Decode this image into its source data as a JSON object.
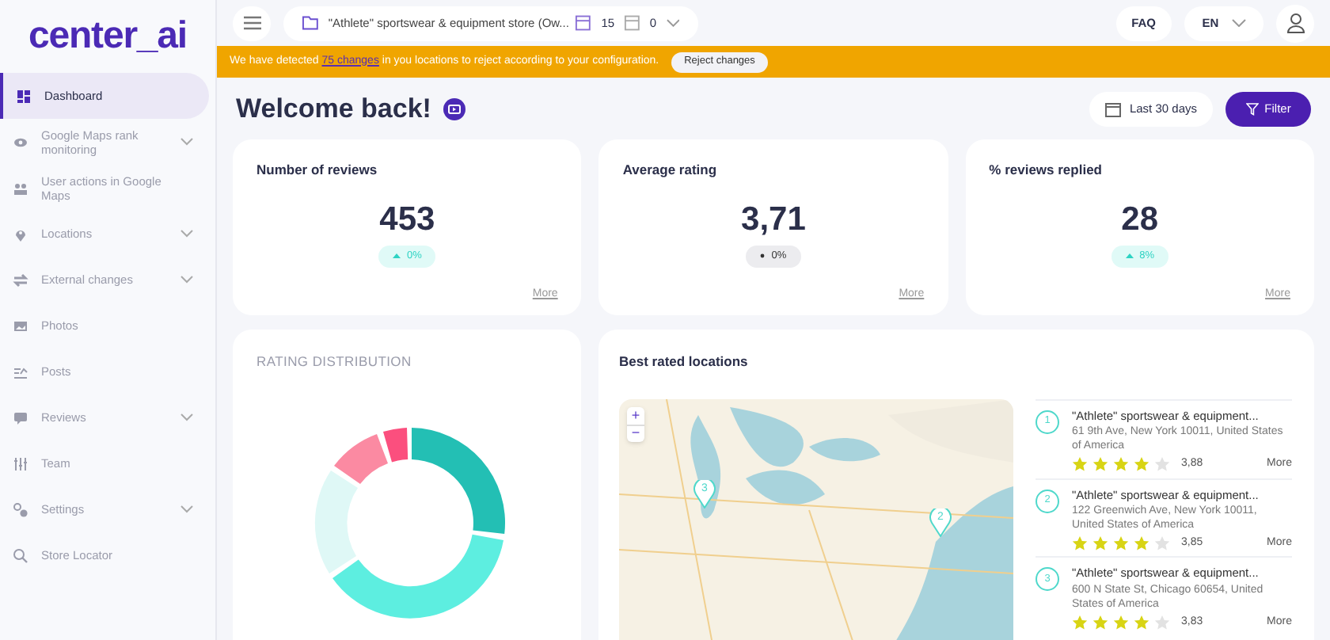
{
  "logo": "center_ai",
  "sidebar": {
    "items": [
      {
        "label": "Dashboard",
        "selected": true,
        "expandable": false
      },
      {
        "label": "Google Maps rank monitoring",
        "selected": false,
        "expandable": true
      },
      {
        "label": "User actions in Google Maps",
        "selected": false,
        "expandable": false
      },
      {
        "label": "Locations",
        "selected": false,
        "expandable": true
      },
      {
        "label": "External changes",
        "selected": false,
        "expandable": true
      },
      {
        "label": "Photos",
        "selected": false,
        "expandable": false
      },
      {
        "label": "Posts",
        "selected": false,
        "expandable": false
      },
      {
        "label": "Reviews",
        "selected": false,
        "expandable": true
      },
      {
        "label": "Team",
        "selected": false,
        "expandable": false
      },
      {
        "label": "Settings",
        "selected": false,
        "expandable": true
      },
      {
        "label": "Store Locator",
        "selected": false,
        "expandable": false
      }
    ]
  },
  "topbar": {
    "store": "\"Athlete\" sportswear & equipment store (Ow...",
    "count_a": "15",
    "count_b": "0",
    "faq": "FAQ",
    "language": "EN"
  },
  "banner": {
    "before": "We have detected ",
    "link": "75 changes",
    "after": " in you locations to reject according to your configuration.",
    "button": "Reject changes"
  },
  "header": {
    "title": "Welcome back!",
    "period": "Last 30 days",
    "filter": "Filter"
  },
  "stats": [
    {
      "title": "Number of reviews",
      "value": "453",
      "kind": "up",
      "change": "0%",
      "more": "More"
    },
    {
      "title": "Average rating",
      "value": "3,71",
      "kind": "flat",
      "change": "0%",
      "more": "More"
    },
    {
      "title": "% reviews replied",
      "value": "28",
      "kind": "up",
      "change": "8%",
      "more": "More"
    }
  ],
  "rating_distribution": {
    "title": "RATING DISTRIBUTION"
  },
  "best_rated": {
    "title": "Best rated locations",
    "map": {
      "zoom_in": "+",
      "zoom_out": "−",
      "markers": [
        {
          "label": "3"
        },
        {
          "label": "2"
        }
      ]
    },
    "locations": [
      {
        "rank": "1",
        "name": "\"Athlete\" sportswear & equipment...",
        "address": "61 9th Ave, New York 10011, United States of America",
        "stars": 4,
        "rating": "3,88",
        "more": "More"
      },
      {
        "rank": "2",
        "name": "\"Athlete\" sportswear & equipment...",
        "address": "122 Greenwich Ave, New York 10011, United States of America",
        "stars": 4,
        "rating": "3,85",
        "more": "More"
      },
      {
        "rank": "3",
        "name": "\"Athlete\" sportswear & equipment...",
        "address": "600 N State St, Chicago 60654, United States of America",
        "stars": 4,
        "rating": "3,83",
        "more": "More"
      }
    ]
  }
}
